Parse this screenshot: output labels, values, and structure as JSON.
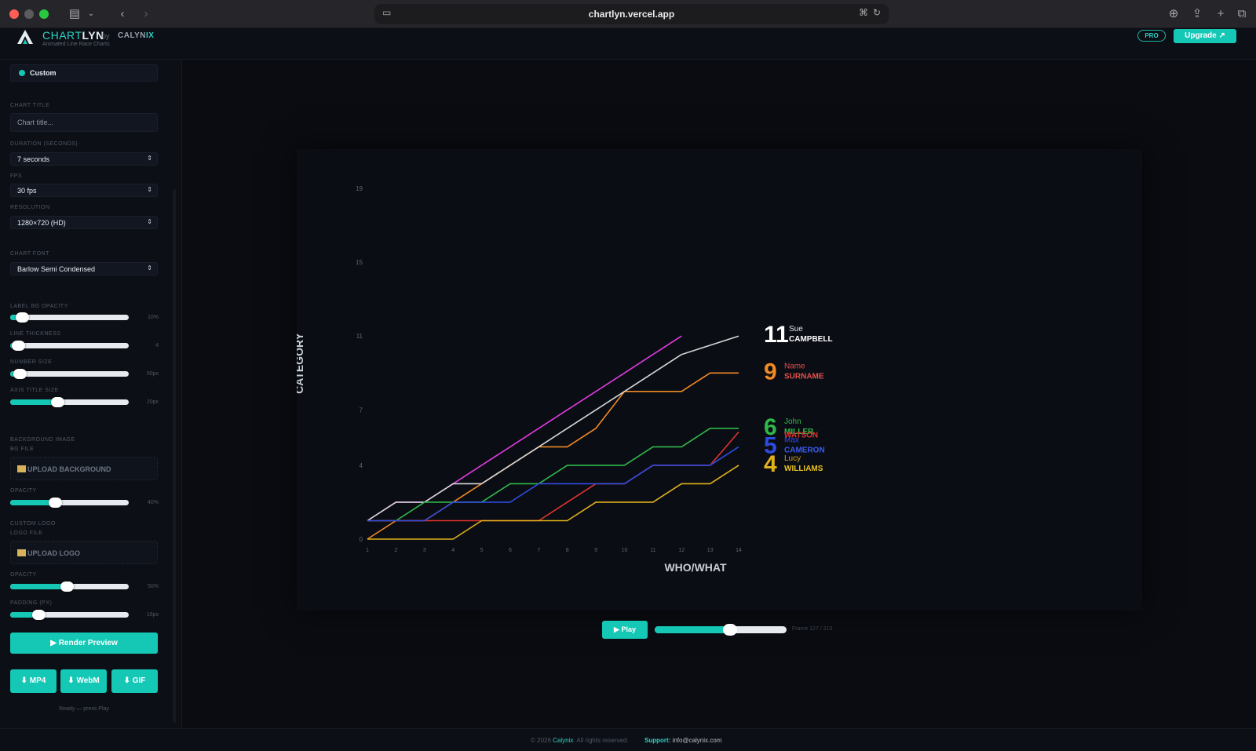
{
  "browser": {
    "url": "chartlyn.vercel.app"
  },
  "header": {
    "brand_a": "CHART",
    "brand_b": "LYN",
    "by": "by",
    "company_a": "CALYN",
    "company_b": "IX",
    "subtitle": "Animated Line Race Charts",
    "pro": "PRO",
    "upgrade": "Upgrade ↗"
  },
  "sidebar": {
    "preset": "Custom",
    "chart_title_label": "CHART TITLE",
    "chart_title_placeholder": "Chart title...",
    "duration_label": "DURATION (SECONDS)",
    "duration_value": "7 seconds",
    "fps_label": "FPS",
    "fps_value": "30 fps",
    "resolution_label": "RESOLUTION",
    "resolution_value": "1280×720 (HD)",
    "font_label": "CHART FONT",
    "font_value": "Barlow Semi Condensed",
    "sliders": [
      {
        "label": "LABEL BG OPACITY",
        "value": "10%",
        "fraction": 0.1
      },
      {
        "label": "LINE THICKNESS",
        "value": "4",
        "fraction": 0.07
      },
      {
        "label": "NUMBER SIZE",
        "value": "50px",
        "fraction": 0.08
      },
      {
        "label": "AXIS TITLE SIZE",
        "value": "20px",
        "fraction": 0.4
      }
    ],
    "bg_section": "BACKGROUND IMAGE",
    "bg_file_label": "BG FILE",
    "bg_upload": "UPLOAD BACKGROUND",
    "bg_opacity_label": "OPACITY",
    "bg_opacity_value": "40%",
    "bg_opacity_fraction": 0.38,
    "logo_section": "CUSTOM LOGO",
    "logo_file_label": "LOGO FILE",
    "logo_upload": "UPLOAD LOGO",
    "logo_opacity_label": "OPACITY",
    "logo_opacity_value": "50%",
    "logo_opacity_fraction": 0.48,
    "padding_label": "PADDING (PX)",
    "padding_value": "16px",
    "padding_fraction": 0.24,
    "render": "▶ Render Preview",
    "mp4": "⬇ MP4",
    "webm": "⬇ WebM",
    "gif": "⬇ GIF",
    "status": "Ready — press Play"
  },
  "player": {
    "play": "▶ Play",
    "progress_fraction": 0.57,
    "frame": "Frame 127 / 210"
  },
  "chart_data": {
    "type": "line",
    "xlabel": "WHO/WHAT",
    "ylabel": "CATEGORY",
    "x": [
      1,
      2,
      3,
      4,
      5,
      6,
      7,
      8,
      9,
      10,
      11,
      12,
      13,
      14
    ],
    "x_ticks": [
      "1",
      "2",
      "3",
      "4",
      "5",
      "6",
      "7",
      "8",
      "9",
      "10",
      "11",
      "12",
      "13",
      "14"
    ],
    "y_ticks": [
      "0",
      "4",
      "7",
      "11",
      "15",
      "19"
    ],
    "grid": false,
    "series": [
      {
        "values": [
          1,
          2,
          2,
          3,
          4,
          5,
          6,
          7,
          8,
          9,
          10,
          11,
          null,
          null
        ],
        "color": "#e03be0"
      },
      {
        "values": [
          0,
          1,
          1,
          2,
          3,
          4,
          5,
          5,
          6,
          8,
          8,
          8,
          9,
          9
        ],
        "color": "#f08a24",
        "first": "Name",
        "last": "SURNAME",
        "num": "9",
        "first_color": "#e0504a",
        "last_color": "#e0504a"
      },
      {
        "values": [
          1,
          2,
          2,
          3,
          3,
          4,
          5,
          6,
          7,
          8,
          9,
          10,
          10.5,
          11
        ],
        "color": "#d7d7d7",
        "first": "Sue",
        "last": "CAMPBELL",
        "num": "11",
        "first_color": "#e6e6e6",
        "last_color": "#ffffff"
      },
      {
        "values": [
          1,
          1,
          2,
          2,
          2,
          3,
          3,
          4,
          4,
          4,
          5,
          5,
          6,
          6
        ],
        "color": "#2fb84a",
        "first": "John",
        "last": "MILLER",
        "num": "6",
        "first_color": "#2fb84a",
        "last_color": "#2fb84a"
      },
      {
        "values": [
          1,
          1,
          1,
          1,
          1,
          1,
          1,
          2,
          3,
          3,
          4,
          4,
          4,
          5.8
        ],
        "color": "#e0342f",
        "first": "",
        "last": "WATSON",
        "num": "",
        "first_color": "#e0342f",
        "last_color": "#e0342f"
      },
      {
        "values": [
          1,
          1,
          1,
          2,
          2,
          2,
          3,
          3,
          3,
          3,
          4,
          4,
          4,
          5
        ],
        "color": "#2e4be0",
        "first": "Max",
        "last": "CAMERON",
        "num": "5",
        "first_color": "#2e4be0",
        "last_color": "#3a5cf0"
      },
      {
        "values": [
          0,
          0,
          0,
          0,
          1,
          1,
          1,
          1,
          2,
          2,
          2,
          3,
          3,
          4
        ],
        "color": "#e0b21a",
        "first": "Lucy",
        "last": "WILLIAMS",
        "num": "4",
        "first_color": "#c9a11a",
        "last_color": "#e8c21e"
      }
    ]
  },
  "footer": {
    "copy_pre": "© 2026",
    "copy_brand": "Calynix",
    "copy_post": ". All rights reserved.",
    "support_label": "Support:",
    "support_email": "info@calynix.com"
  }
}
